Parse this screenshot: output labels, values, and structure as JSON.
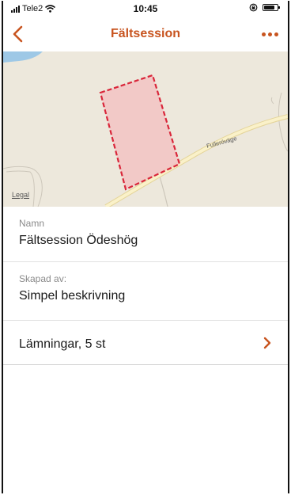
{
  "status_bar": {
    "carrier": "Tele2",
    "time": "10:45"
  },
  "nav": {
    "title": "Fältsession"
  },
  "map": {
    "road_label": "Fulleröväge",
    "legal_label": "Legal"
  },
  "details": {
    "name_label": "Namn",
    "name_value": "Fältsession Ödeshög",
    "created_label": "Skapad av:",
    "created_value": "Simpel beskrivning",
    "remains_label": "Lämningar, 5 st"
  },
  "colors": {
    "accent": "#c8541f",
    "polygon_stroke": "#d9263a",
    "polygon_fill": "#f2c3c3"
  }
}
